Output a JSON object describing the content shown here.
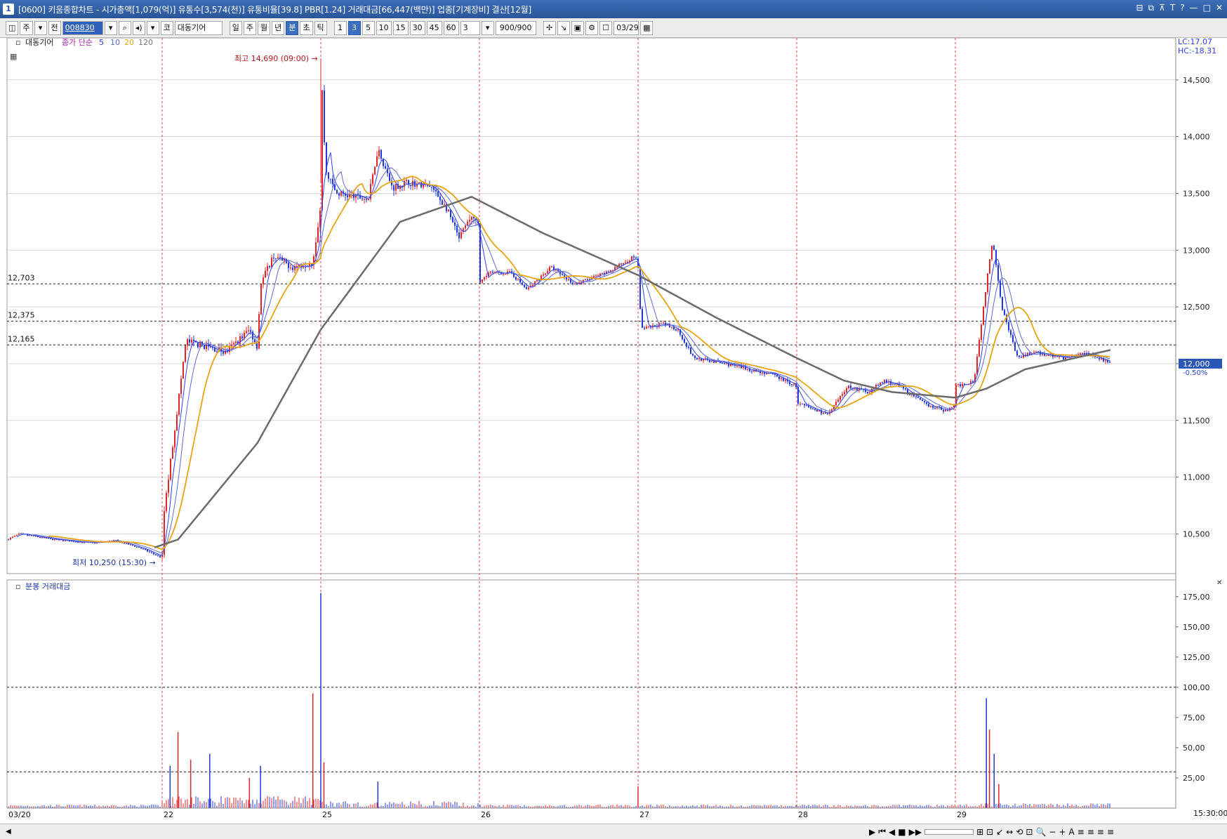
{
  "window": {
    "badge": "1",
    "title": "[0600] 키움종합차트 - 시가총액[1,079(억)] 유통수[3,574(천)] 유통비율[39.8] PBR[1.24] 거래대금[66,447(백만)] 업종[기계장비] 결산[12월]",
    "buttons": [
      "⊟",
      "⧉",
      "⊼",
      "T",
      "?",
      "—",
      "□",
      "✕"
    ]
  },
  "toolbar": {
    "market": "주",
    "type": "전",
    "code": "008830",
    "market_tag": "코",
    "stock_name": "대동기어",
    "periods": [
      "일",
      "주",
      "월",
      "년",
      "분",
      "초",
      "틱"
    ],
    "period_active": "분",
    "intervals": [
      "1",
      "3",
      "5",
      "10",
      "15",
      "30",
      "45",
      "60"
    ],
    "interval_active": "3",
    "interval_select": "3",
    "count": "900",
    "count_total": "/900",
    "date": "03/29"
  },
  "colors": {
    "up": "#e0262a",
    "down": "#2038d8",
    "ma5": "#2a3ef0",
    "ma10": "#5a6ad8",
    "ma20": "#e8a410",
    "ma120": "#6b6b6b",
    "grid": "#d8d8d8",
    "day_divider": "#e04040",
    "current_price_bg": "#2a56b8"
  },
  "chart_data": {
    "type": "candlestick",
    "timeframe": "3분",
    "stock": "대동기어",
    "price_panel": {
      "legend_name": "대동기어",
      "legend_ma_label": "종가 단순",
      "legend_ma_periods": [
        "5",
        "10",
        "20",
        "120"
      ],
      "icon_label": "▦",
      "ylim": [
        10150,
        14870
      ],
      "y_ticks": [
        10500,
        11000,
        11500,
        12000,
        12500,
        13000,
        13500,
        14000,
        14500
      ],
      "y_tick_labels": [
        "10,500",
        "11,000",
        "11,500",
        "12,000",
        "12,500",
        "13,000",
        "13,500",
        "14,000",
        "14,500"
      ],
      "high": {
        "label": "최고 14,690 (09:00)",
        "value": 14690,
        "day": "25"
      },
      "low": {
        "label": "최저 10,250 (15:30)",
        "value": 10250,
        "day": "03/20"
      },
      "levels": [
        {
          "value": 12703,
          "label": "12,703"
        },
        {
          "value": 12375,
          "label": "12,375"
        },
        {
          "value": 12165,
          "label": "12,165"
        }
      ],
      "current_price": {
        "value": 12000,
        "label": "12,000",
        "change": "-0.50%"
      },
      "lc_label": "LC:17.07",
      "hc_label": "HC:-18.31"
    },
    "days": [
      "03/20",
      "22",
      "25",
      "26",
      "27",
      "28",
      "29"
    ],
    "time_label": "15:30:00",
    "price_path": [
      {
        "day": 0,
        "t": 0.0,
        "v": 10450
      },
      {
        "day": 0,
        "t": 0.08,
        "v": 10500
      },
      {
        "day": 0,
        "t": 0.3,
        "v": 10450
      },
      {
        "day": 0,
        "t": 0.55,
        "v": 10420
      },
      {
        "day": 0,
        "t": 0.7,
        "v": 10440
      },
      {
        "day": 0,
        "t": 0.85,
        "v": 10380
      },
      {
        "day": 0,
        "t": 1.0,
        "v": 10290
      },
      {
        "day": 1,
        "t": 0.0,
        "v": 10560
      },
      {
        "day": 1,
        "t": 0.1,
        "v": 11650
      },
      {
        "day": 1,
        "t": 0.15,
        "v": 12200
      },
      {
        "day": 1,
        "t": 0.28,
        "v": 12150
      },
      {
        "day": 1,
        "t": 0.4,
        "v": 12100
      },
      {
        "day": 1,
        "t": 0.55,
        "v": 12300
      },
      {
        "day": 1,
        "t": 0.6,
        "v": 12150
      },
      {
        "day": 1,
        "t": 0.62,
        "v": 12700
      },
      {
        "day": 1,
        "t": 0.7,
        "v": 12950
      },
      {
        "day": 1,
        "t": 0.82,
        "v": 12850
      },
      {
        "day": 1,
        "t": 0.95,
        "v": 12900
      },
      {
        "day": 1,
        "t": 1.0,
        "v": 13400
      },
      {
        "day": 2,
        "t": 0.0,
        "v": 14690
      },
      {
        "day": 2,
        "t": 0.03,
        "v": 13700
      },
      {
        "day": 2,
        "t": 0.1,
        "v": 13500
      },
      {
        "day": 2,
        "t": 0.3,
        "v": 13450
      },
      {
        "day": 2,
        "t": 0.36,
        "v": 13900
      },
      {
        "day": 2,
        "t": 0.45,
        "v": 13550
      },
      {
        "day": 2,
        "t": 0.55,
        "v": 13600
      },
      {
        "day": 2,
        "t": 0.7,
        "v": 13550
      },
      {
        "day": 2,
        "t": 0.8,
        "v": 13350
      },
      {
        "day": 2,
        "t": 0.87,
        "v": 13100
      },
      {
        "day": 2,
        "t": 0.95,
        "v": 13300
      },
      {
        "day": 2,
        "t": 1.0,
        "v": 13200
      },
      {
        "day": 3,
        "t": 0.0,
        "v": 12700
      },
      {
        "day": 3,
        "t": 0.05,
        "v": 12800
      },
      {
        "day": 3,
        "t": 0.2,
        "v": 12800
      },
      {
        "day": 3,
        "t": 0.3,
        "v": 12650
      },
      {
        "day": 3,
        "t": 0.45,
        "v": 12850
      },
      {
        "day": 3,
        "t": 0.6,
        "v": 12700
      },
      {
        "day": 3,
        "t": 0.8,
        "v": 12800
      },
      {
        "day": 3,
        "t": 0.98,
        "v": 12950
      },
      {
        "day": 3,
        "t": 1.0,
        "v": 12850
      },
      {
        "day": 4,
        "t": 0.02,
        "v": 12300
      },
      {
        "day": 4,
        "t": 0.15,
        "v": 12350
      },
      {
        "day": 4,
        "t": 0.25,
        "v": 12300
      },
      {
        "day": 4,
        "t": 0.35,
        "v": 12050
      },
      {
        "day": 4,
        "t": 0.55,
        "v": 12000
      },
      {
        "day": 4,
        "t": 0.7,
        "v": 11950
      },
      {
        "day": 4,
        "t": 0.85,
        "v": 11900
      },
      {
        "day": 4,
        "t": 1.0,
        "v": 11800
      },
      {
        "day": 5,
        "t": 0.0,
        "v": 11650
      },
      {
        "day": 5,
        "t": 0.2,
        "v": 11550
      },
      {
        "day": 5,
        "t": 0.32,
        "v": 11800
      },
      {
        "day": 5,
        "t": 0.45,
        "v": 11750
      },
      {
        "day": 5,
        "t": 0.55,
        "v": 11850
      },
      {
        "day": 5,
        "t": 0.65,
        "v": 11800
      },
      {
        "day": 5,
        "t": 0.8,
        "v": 11650
      },
      {
        "day": 5,
        "t": 0.95,
        "v": 11580
      },
      {
        "day": 5,
        "t": 1.0,
        "v": 11650
      },
      {
        "day": 6,
        "t": 0.0,
        "v": 11800
      },
      {
        "day": 6,
        "t": 0.12,
        "v": 11850
      },
      {
        "day": 6,
        "t": 0.2,
        "v": 12700
      },
      {
        "day": 6,
        "t": 0.24,
        "v": 13100
      },
      {
        "day": 6,
        "t": 0.3,
        "v": 12500
      },
      {
        "day": 6,
        "t": 0.4,
        "v": 12050
      },
      {
        "day": 6,
        "t": 0.5,
        "v": 12100
      },
      {
        "day": 6,
        "t": 0.7,
        "v": 12050
      },
      {
        "day": 6,
        "t": 0.85,
        "v": 12100
      },
      {
        "day": 6,
        "t": 1.0,
        "v": 12000
      }
    ],
    "ma120_path": [
      {
        "day": 0,
        "t": 0.95,
        "v": 10380
      },
      {
        "day": 1,
        "t": 0.1,
        "v": 10450
      },
      {
        "day": 1,
        "t": 0.6,
        "v": 11300
      },
      {
        "day": 1,
        "t": 1.0,
        "v": 12300
      },
      {
        "day": 2,
        "t": 0.5,
        "v": 13250
      },
      {
        "day": 2,
        "t": 0.95,
        "v": 13470
      },
      {
        "day": 3,
        "t": 0.4,
        "v": 13150
      },
      {
        "day": 3,
        "t": 1.0,
        "v": 12780
      },
      {
        "day": 4,
        "t": 0.5,
        "v": 12400
      },
      {
        "day": 5,
        "t": 0.0,
        "v": 12050
      },
      {
        "day": 5,
        "t": 0.3,
        "v": 11850
      },
      {
        "day": 5,
        "t": 0.6,
        "v": 11750
      },
      {
        "day": 6,
        "t": 0.0,
        "v": 11700
      },
      {
        "day": 6,
        "t": 0.2,
        "v": 11780
      },
      {
        "day": 6,
        "t": 0.45,
        "v": 11950
      },
      {
        "day": 6,
        "t": 1.0,
        "v": 12120
      }
    ],
    "volume_panel": {
      "legend": "분봉 거래대금",
      "ylim": [
        0,
        183
      ],
      "y_ticks": [
        25,
        50,
        75,
        100,
        125,
        150,
        175
      ],
      "y_tick_labels": [
        "25,00",
        "50,00",
        "75,00",
        "100,00",
        "125,00",
        "150,00",
        "175,00"
      ],
      "levels": [
        100,
        30
      ],
      "spikes": [
        {
          "day": 1,
          "t": 0.1,
          "v": 63
        },
        {
          "day": 1,
          "t": 0.05,
          "v": 35
        },
        {
          "day": 1,
          "t": 0.18,
          "v": 40
        },
        {
          "day": 1,
          "t": 0.3,
          "v": 45
        },
        {
          "day": 1,
          "t": 0.55,
          "v": 25
        },
        {
          "day": 1,
          "t": 0.62,
          "v": 35
        },
        {
          "day": 1,
          "t": 0.95,
          "v": 95
        },
        {
          "day": 2,
          "t": 0.0,
          "v": 178
        },
        {
          "day": 2,
          "t": 0.02,
          "v": 38
        },
        {
          "day": 2,
          "t": 0.36,
          "v": 22
        },
        {
          "day": 4,
          "t": 0.0,
          "v": 18
        },
        {
          "day": 6,
          "t": 0.2,
          "v": 91
        },
        {
          "day": 6,
          "t": 0.22,
          "v": 65
        },
        {
          "day": 6,
          "t": 0.25,
          "v": 45
        },
        {
          "day": 6,
          "t": 0.28,
          "v": 20
        }
      ]
    }
  },
  "statusbar": {
    "left_arrow": "◀",
    "controls": [
      "▶",
      "⏮",
      "◀",
      "■",
      "▶▶",
      "⊞",
      "⊡",
      "↙",
      "↔",
      "⟲",
      "⊡",
      "🔍",
      "−",
      "+",
      "A",
      "≡",
      "≡",
      "≡",
      "≡"
    ]
  }
}
